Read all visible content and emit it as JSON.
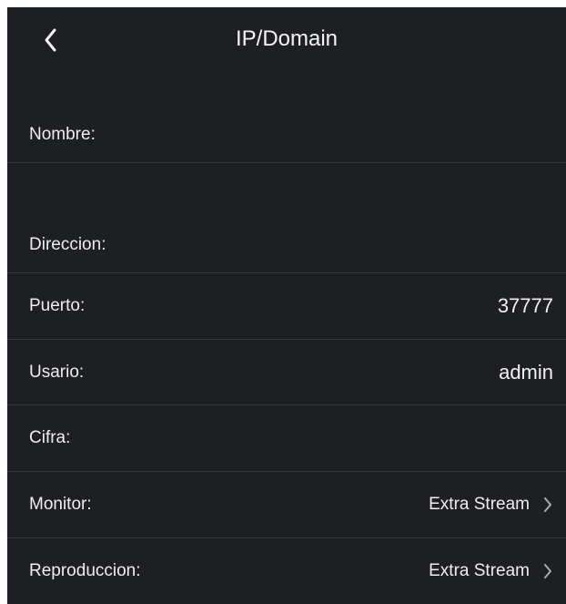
{
  "header": {
    "title": "IP/Domain"
  },
  "icons": {
    "back": "chevron-left-icon",
    "chevron": "chevron-right-icon"
  },
  "form": {
    "nombre": {
      "label": "Nombre:",
      "value": ""
    },
    "direccion": {
      "label": "Direccion:",
      "value": ""
    },
    "puerto": {
      "label": "Puerto:",
      "value": "37777"
    },
    "usario": {
      "label": "Usario:",
      "value": "admin"
    },
    "cifra": {
      "label": "Cifra:",
      "value": ""
    },
    "monitor": {
      "label": "Monitor:",
      "value": "Extra Stream"
    },
    "reproduccion": {
      "label": "Reproduccion:",
      "value": "Extra Stream"
    }
  }
}
